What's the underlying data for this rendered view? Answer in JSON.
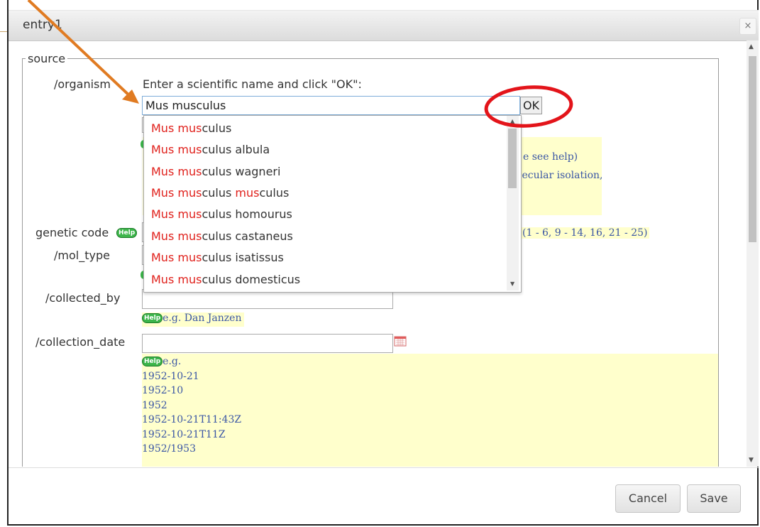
{
  "dialog": {
    "title": "entry1",
    "close_icon": "×"
  },
  "form": {
    "legend": "source",
    "organism": {
      "label": "/organism",
      "instruction": "Enter a scientific name and click \"OK\":",
      "value": "Mus musculus",
      "ok_label": "OK",
      "hint_partial_1": "e see help)",
      "hint_partial_2": "lecular isolation,"
    },
    "genetic_code": {
      "label": "genetic code",
      "help": "Help",
      "hint": "(1 - 6, 9 - 14, 16, 21 - 25)"
    },
    "mol_type": {
      "label": "/mol_type"
    },
    "collected_by": {
      "label": "/collected_by",
      "help": "Help",
      "hint": "e.g. Dan Janzen"
    },
    "collection_date": {
      "label": "/collection_date",
      "help": "Help",
      "hint_head": "e.g.",
      "examples": [
        "1952-10-21",
        "1952-10",
        "1952",
        "1952-10-21T11:43Z",
        "1952-10-21T11Z",
        "1952/1953"
      ]
    }
  },
  "autocomplete": {
    "items": [
      {
        "match": "Mus mus",
        "rest": "culus"
      },
      {
        "match": "Mus mus",
        "rest": "culus albula"
      },
      {
        "match": "Mus mus",
        "rest": "culus wagneri"
      },
      {
        "match": "Mus mus",
        "rest": "culus ",
        "match2": "mus",
        "rest2": "culus"
      },
      {
        "match": "Mus mus",
        "rest": "culus homourus"
      },
      {
        "match": "Mus mus",
        "rest": "culus castaneus"
      },
      {
        "match": "Mus mus",
        "rest": "culus isatissus"
      },
      {
        "match": "Mus mus",
        "rest": "culus domesticus"
      }
    ]
  },
  "footer": {
    "cancel_label": "Cancel",
    "save_label": "Save"
  },
  "colors": {
    "annotation_arrow": "#e07b22",
    "highlight_circle": "#e3141a",
    "match_text": "#e0201b",
    "hint_bg": "#ffffcc"
  }
}
